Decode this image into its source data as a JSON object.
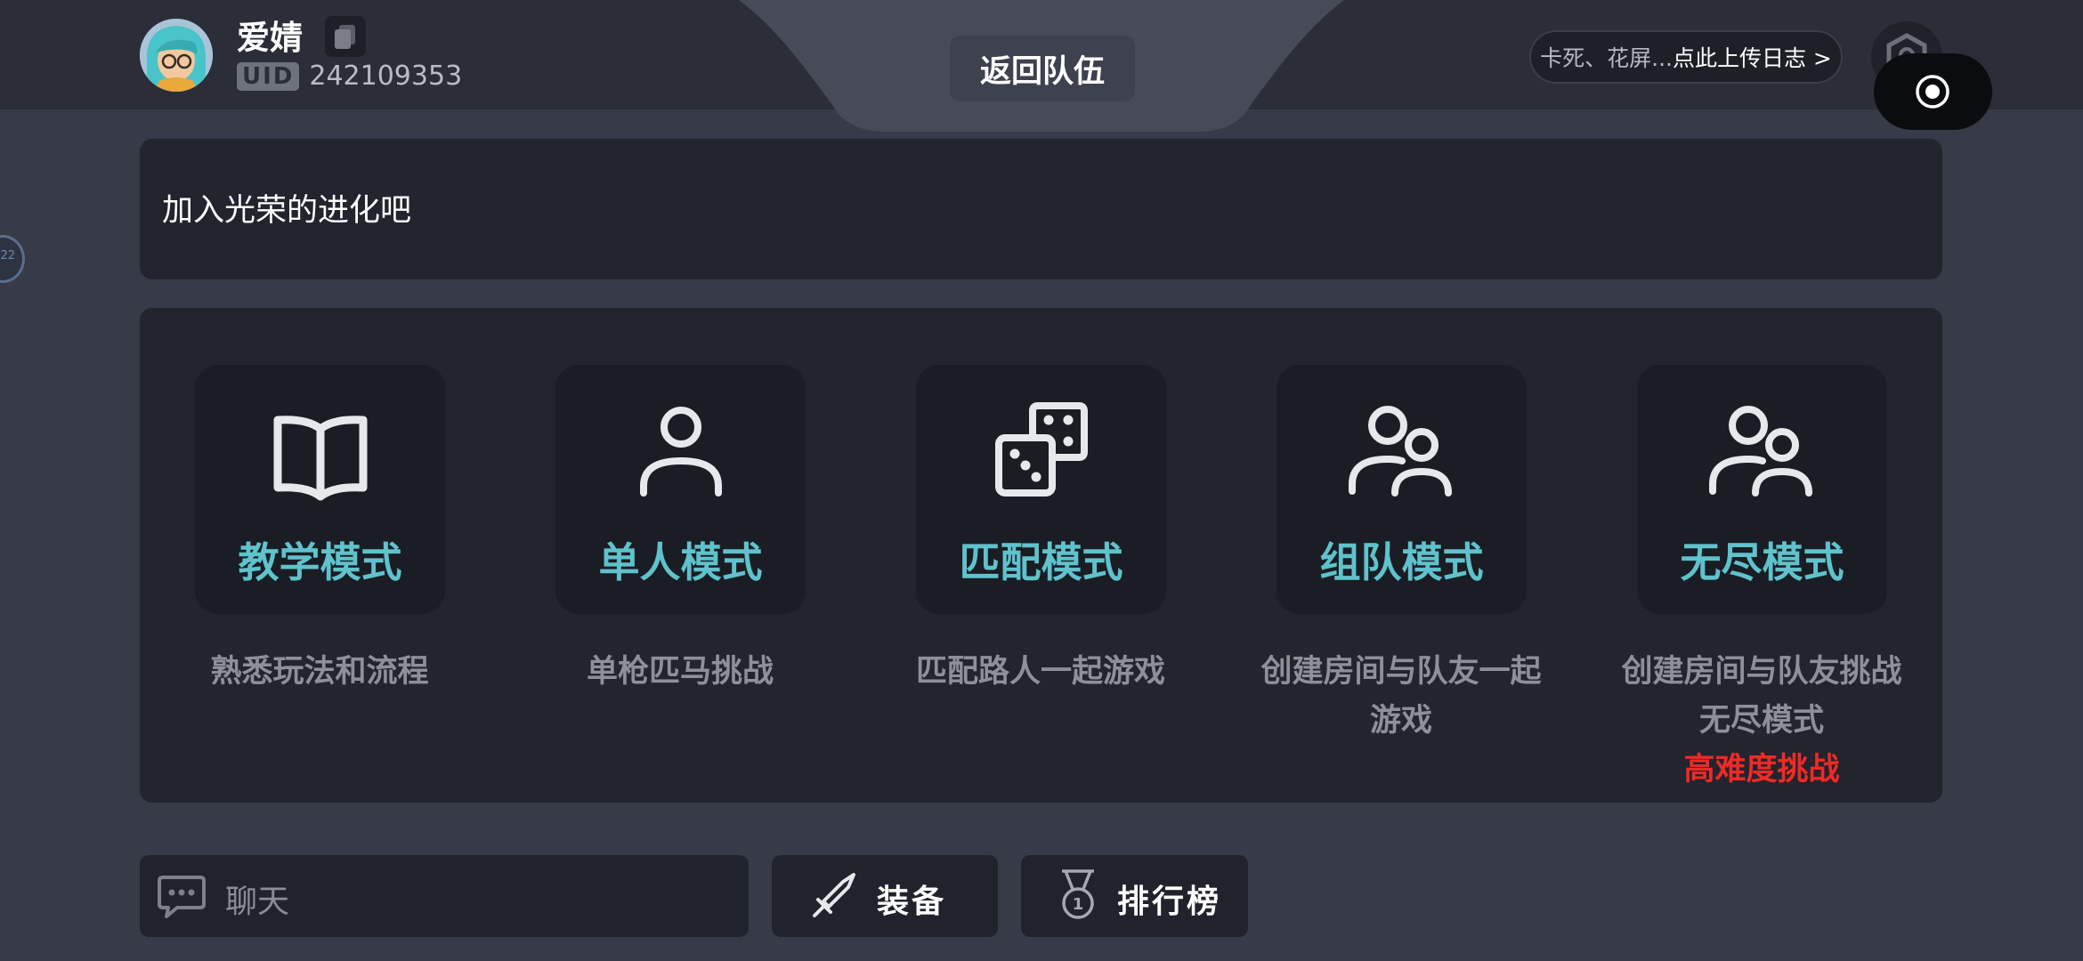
{
  "profile": {
    "username": "爱婧",
    "uid_label": "UID",
    "uid_value": "242109353"
  },
  "header": {
    "back_to_team": "返回队伍",
    "log_hint": "卡死、花屏...",
    "log_action": "点此上传日志 >"
  },
  "side_handle": {
    "label": "22"
  },
  "banner": {
    "text": "加入光荣的进化吧"
  },
  "modes": [
    {
      "title": "教学模式",
      "desc": "熟悉玩法和流程",
      "icon": "book-icon"
    },
    {
      "title": "单人模式",
      "desc": "单枪匹马挑战",
      "icon": "person-icon"
    },
    {
      "title": "匹配模式",
      "desc": "匹配路人一起游戏",
      "icon": "dice-icon"
    },
    {
      "title": "组队模式",
      "desc_line1": "创建房间与队友一起",
      "desc_line2": "游戏",
      "icon": "group-icon"
    },
    {
      "title": "无尽模式",
      "desc_line1": "创建房间与队友挑战",
      "desc_line2": "无尽模式",
      "warning": "高难度挑战",
      "icon": "group-icon"
    }
  ],
  "bottom": {
    "chat_placeholder": "聊天",
    "equip_label": "装备",
    "rank_label": "排行榜"
  },
  "colors": {
    "accent": "#5fc2cc",
    "warning": "#ef2a26",
    "background": "#373b47",
    "panel": "#22242e"
  }
}
